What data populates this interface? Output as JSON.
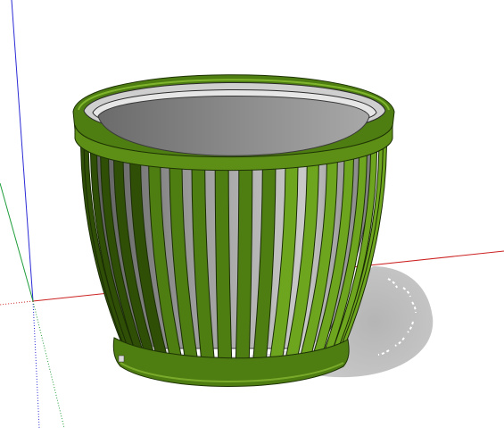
{
  "viewport": {
    "background": "#ffffff",
    "model_icon": "green-slatted-planter-basket-3d-model",
    "colors": {
      "axis_red": "#cc2222",
      "axis_green": "#1f9d3a",
      "axis_blue": "#2a2ad6",
      "slat_green": "#4e7d11",
      "slat_green_light": "#6ea51f",
      "slat_green_dark": "#2f4f07",
      "liner_gray": "#7d7d7d",
      "liner_light": "#c8c8c8",
      "shadow_gray": "#bdbdbd"
    },
    "slat_count": 20
  }
}
